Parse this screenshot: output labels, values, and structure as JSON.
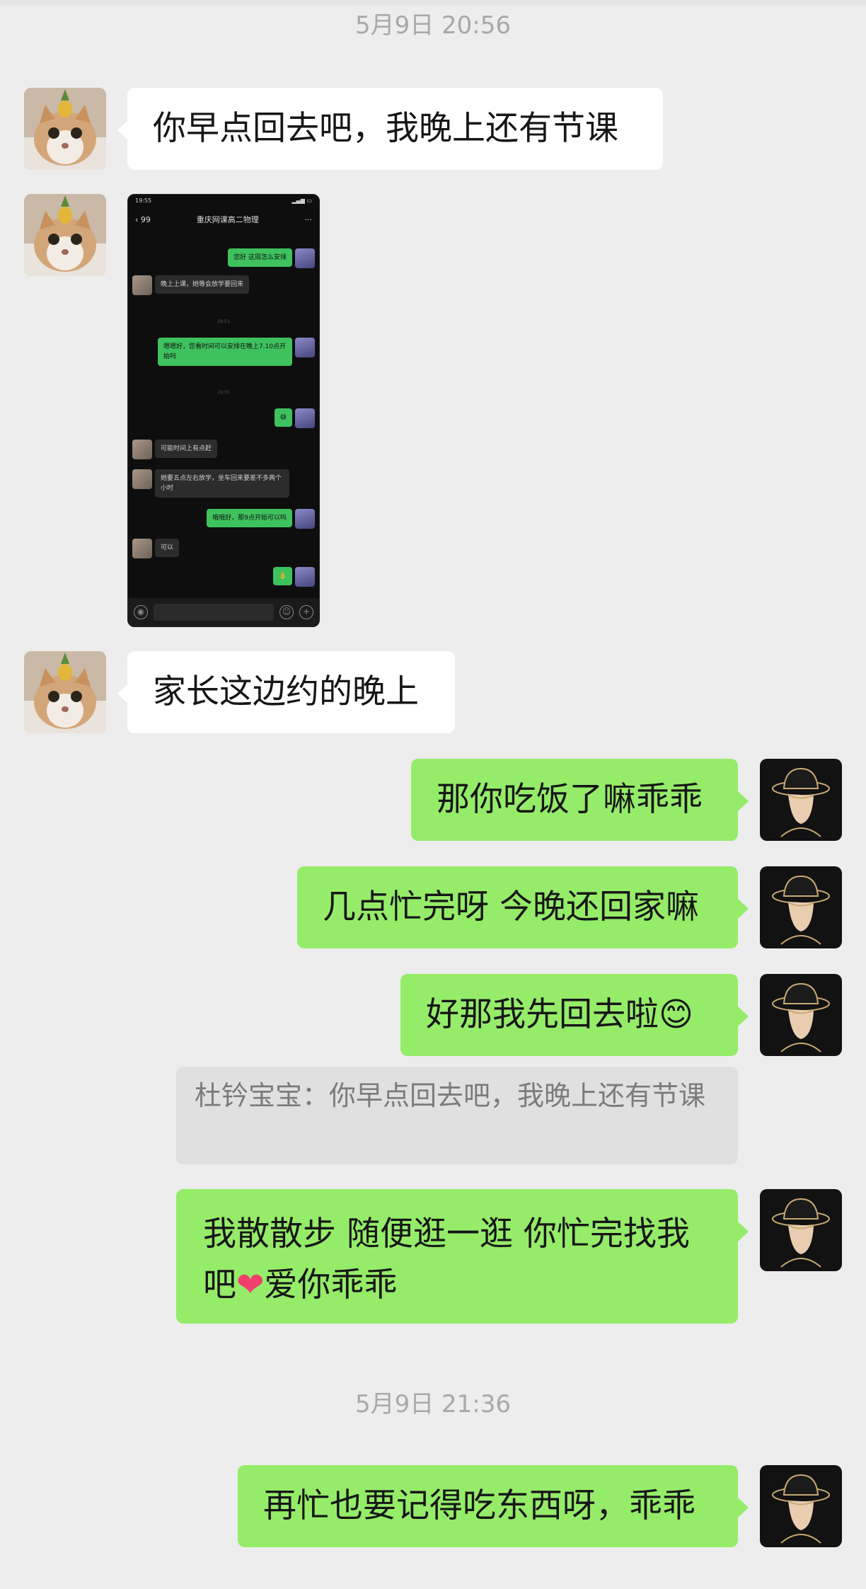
{
  "timestamps": [
    "5月9日 20:56",
    "5月9日 21:36"
  ],
  "messages": {
    "m1": "你早点回去吧，我晚上还有节课",
    "m3": "家长这边约的晚上",
    "m4": "那你吃饭了嘛乖乖",
    "m5": "几点忙完呀 今晚还回家嘛",
    "m6": "好那我先回去啦",
    "m6_emoji": "😊",
    "quote": "杜钤宝宝：你早点回去吧，我晚上还有节课",
    "m7_line1": "我散散步 随便逛一逛 你忙完找我",
    "m7_line2_a": "吧",
    "m7_heart": "❤",
    "m7_line2_b": "爱你乖乖",
    "m8": "再忙也要记得吃东西呀，乖乖"
  },
  "screenshot": {
    "status_time": "19:55",
    "title": "重庆网课高二物理",
    "back_count": "99",
    "msgs": [
      "您好 这周怎么安排",
      "晚上上课，她等会放学要回来",
      "嗯嗯好，您看时间可以安排在晚上7.10点开始吗",
      "可能时间上有点赶",
      "她要五点左右放学，坐车回来要差不多两个小时",
      "哦哦好，那9点开始可以吗",
      "可以"
    ],
    "times": [
      "19:53",
      "19:55"
    ]
  },
  "colors": {
    "background": "#ededed",
    "incoming_bubble": "#ffffff",
    "outgoing_bubble": "#95ec69",
    "quote_bg": "#e0e0e0",
    "timestamp": "#a8a8a8"
  },
  "icons": [
    "cat-avatar-icon",
    "hat-man-avatar-icon",
    "heart-icon",
    "smile-emoji-icon"
  ]
}
